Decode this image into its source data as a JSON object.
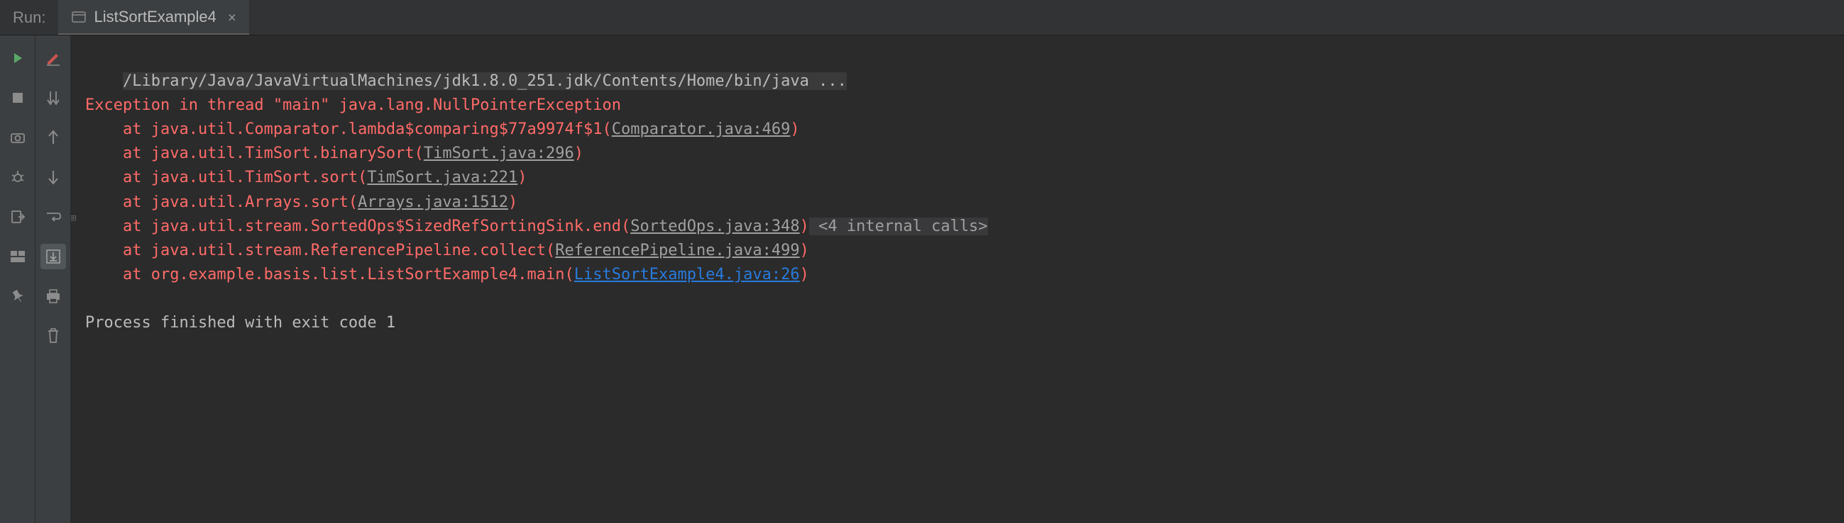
{
  "header": {
    "run_label": "Run:",
    "tab_label": "ListSortExample4",
    "tab_close": "×"
  },
  "console": {
    "cmd": "/Library/Java/JavaVirtualMachines/jdk1.8.0_251.jdk/Contents/Home/bin/java ...",
    "exception": "Exception in thread \"main\" java.lang.NullPointerException",
    "trace": [
      {
        "prefix": "    at java.util.Comparator.lambda$comparing$77a9974f$1(",
        "link": "Comparator.java:469",
        "suffix": ")",
        "blue": false
      },
      {
        "prefix": "    at java.util.TimSort.binarySort(",
        "link": "TimSort.java:296",
        "suffix": ")",
        "blue": false
      },
      {
        "prefix": "    at java.util.TimSort.sort(",
        "link": "TimSort.java:221",
        "suffix": ")",
        "blue": false
      },
      {
        "prefix": "    at java.util.Arrays.sort(",
        "link": "Arrays.java:1512",
        "suffix": ")",
        "blue": false
      },
      {
        "prefix": "    at java.util.stream.SortedOps$SizedRefSortingSink.end(",
        "link": "SortedOps.java:348",
        "suffix": ")",
        "blue": false,
        "fold": " <4 internal calls>"
      },
      {
        "prefix": "    at java.util.stream.ReferencePipeline.collect(",
        "link": "ReferencePipeline.java:499",
        "suffix": ")",
        "blue": false
      },
      {
        "prefix": "    at org.example.basis.list.ListSortExample4.main(",
        "link": "ListSortExample4.java:26",
        "suffix": ")",
        "blue": true
      }
    ],
    "exit": "Process finished with exit code 1"
  }
}
